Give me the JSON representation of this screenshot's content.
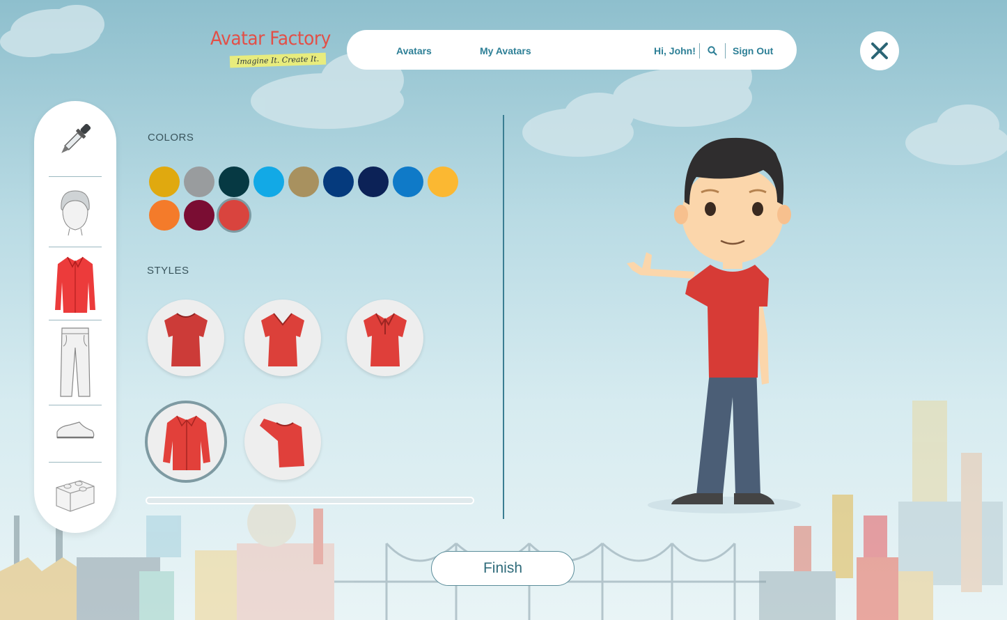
{
  "logo": {
    "title": "Avatar Factory",
    "tagline": "Imagine It. Create It."
  },
  "nav": {
    "avatars": "Avatars",
    "my_avatars": "My Avatars",
    "greeting": "Hi, John!",
    "search_icon": "search-icon",
    "sign_out": "Sign Out"
  },
  "close_icon": "close-icon",
  "toolbar": {
    "items": [
      {
        "name": "eyedropper",
        "icon": "eyedropper-icon"
      },
      {
        "name": "face",
        "icon": "face-icon"
      },
      {
        "name": "shirt",
        "icon": "shirt-icon",
        "selected": true
      },
      {
        "name": "pants",
        "icon": "pants-icon"
      },
      {
        "name": "shoes",
        "icon": "shoe-icon"
      },
      {
        "name": "accessory",
        "icon": "box-icon"
      }
    ]
  },
  "colors": {
    "title": "COLORS",
    "swatches": [
      "#e0a90f",
      "#999c9e",
      "#063943",
      "#12a9e6",
      "#a8915f",
      "#053a7d",
      "#0c2257",
      "#0f7ac8",
      "#fbb832",
      "#f47b2a",
      "#7a0d33",
      "#d9443e"
    ],
    "selected_index": 11
  },
  "styles": {
    "title": "STYLES",
    "options": [
      "crew-neck-tee",
      "v-neck-tee",
      "polo-shirt",
      "button-shirt",
      "long-sleeve-tee"
    ],
    "selected_index": 3,
    "shirt_color": "#e0413a"
  },
  "finish": "Finish"
}
